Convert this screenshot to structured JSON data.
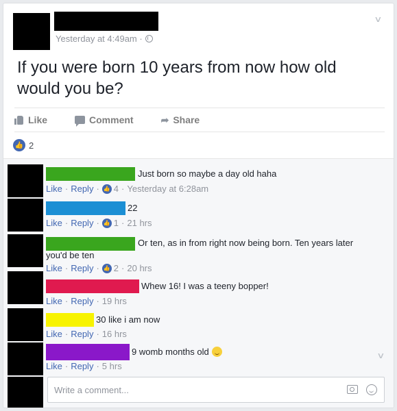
{
  "post": {
    "timestamp": "Yesterday at 4:49am · ",
    "text": "If you were born 10 years from now how old would you be?",
    "actions": {
      "like": "Like",
      "comment": "Comment",
      "share": "Share"
    },
    "like_count": "2"
  },
  "comments": [
    {
      "text": "Just born so maybe a day old haha",
      "like": "Like",
      "reply": "Reply",
      "reactions": "4",
      "time": "Yesterday at 6:28am",
      "bar_color": "#3aa61e"
    },
    {
      "text": "22",
      "like": "Like",
      "reply": "Reply",
      "reactions": "1",
      "time": "21 hrs",
      "bar_color": "#1c8fd4"
    },
    {
      "text": "Or ten, as in from right now being born. Ten years later you'd be ten",
      "like": "Like",
      "reply": "Reply",
      "reactions": "2",
      "time": "20 hrs",
      "bar_color": "#3aa61e"
    },
    {
      "text": "Whew 16! I was a teeny bopper!",
      "like": "Like",
      "reply": "Reply",
      "time": "19 hrs",
      "bar_color": "#e01a4f"
    },
    {
      "text": "30 like i am now",
      "like": "Like",
      "reply": "Reply",
      "time": "16 hrs",
      "bar_color": "#f7f300"
    },
    {
      "text": "9 womb months old",
      "like": "Like",
      "reply": "Reply",
      "time": "5 hrs",
      "bar_color": "#8a18c9"
    }
  ],
  "composer": {
    "placeholder": "Write a comment..."
  },
  "icons": {
    "like": "thumbs-up-icon",
    "comment": "speech-bubble-icon",
    "share": "share-arrow-icon",
    "camera": "camera-icon",
    "emoji": "smiley-icon",
    "globe": "globe-icon"
  }
}
